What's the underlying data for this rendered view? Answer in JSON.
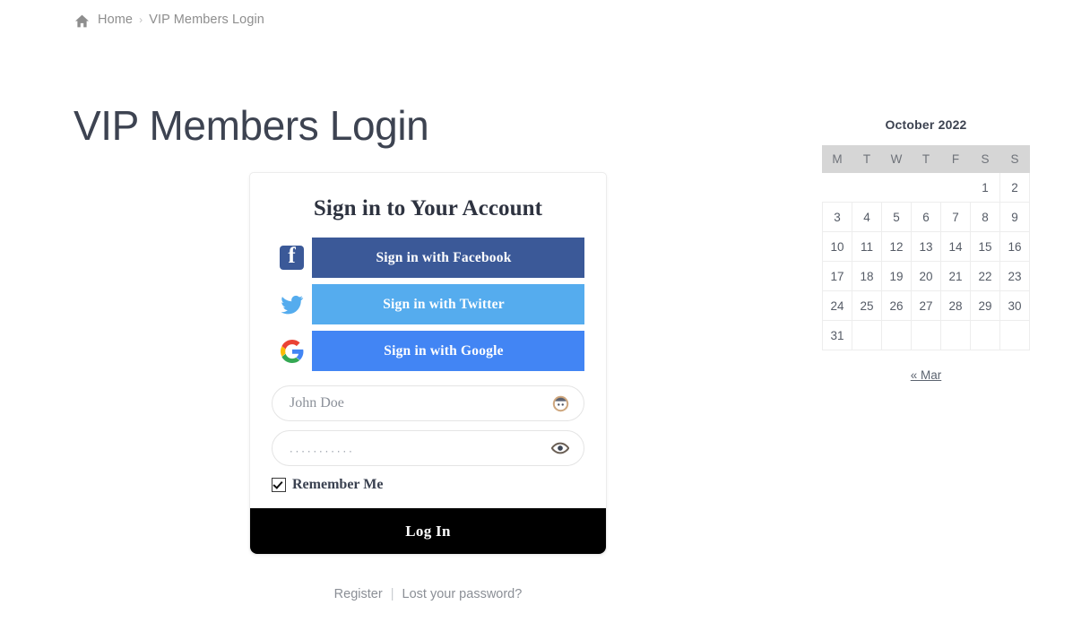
{
  "breadcrumb": {
    "home_icon": "home-icon",
    "home_label": "Home",
    "separator": "›",
    "current": "VIP Members Login"
  },
  "page": {
    "title": "VIP Members Login"
  },
  "login_card": {
    "title": "Sign in to Your Account",
    "social_buttons": [
      {
        "label": "Sign in with Facebook",
        "icon": "facebook-icon",
        "color": "#3b5998"
      },
      {
        "label": "Sign in with Twitter",
        "icon": "twitter-icon",
        "color": "#55acee"
      },
      {
        "label": "Sign in with Google",
        "icon": "google-icon",
        "color": "#4285f4"
      }
    ],
    "username": {
      "placeholder": "John Doe",
      "value": "",
      "icon": "user-face-icon"
    },
    "password": {
      "value": "...........",
      "icon": "eye-icon"
    },
    "remember": {
      "label": "Remember Me",
      "checked": true
    },
    "submit_label": "Log In",
    "footer": {
      "register_label": "Register",
      "divider": "|",
      "lost_password_label": "Lost your password?"
    }
  },
  "calendar": {
    "caption": "October 2022",
    "weekdays": [
      "M",
      "T",
      "W",
      "T",
      "F",
      "S",
      "S"
    ],
    "weeks": [
      [
        "",
        "",
        "",
        "",
        "",
        "1",
        "2"
      ],
      [
        "3",
        "4",
        "5",
        "6",
        "7",
        "8",
        "9"
      ],
      [
        "10",
        "11",
        "12",
        "13",
        "14",
        "15",
        "16"
      ],
      [
        "17",
        "18",
        "19",
        "20",
        "21",
        "22",
        "23"
      ],
      [
        "24",
        "25",
        "26",
        "27",
        "28",
        "29",
        "30"
      ],
      [
        "31",
        "",
        "",
        "",
        "",
        "",
        ""
      ]
    ],
    "prev_label": "« Mar"
  }
}
